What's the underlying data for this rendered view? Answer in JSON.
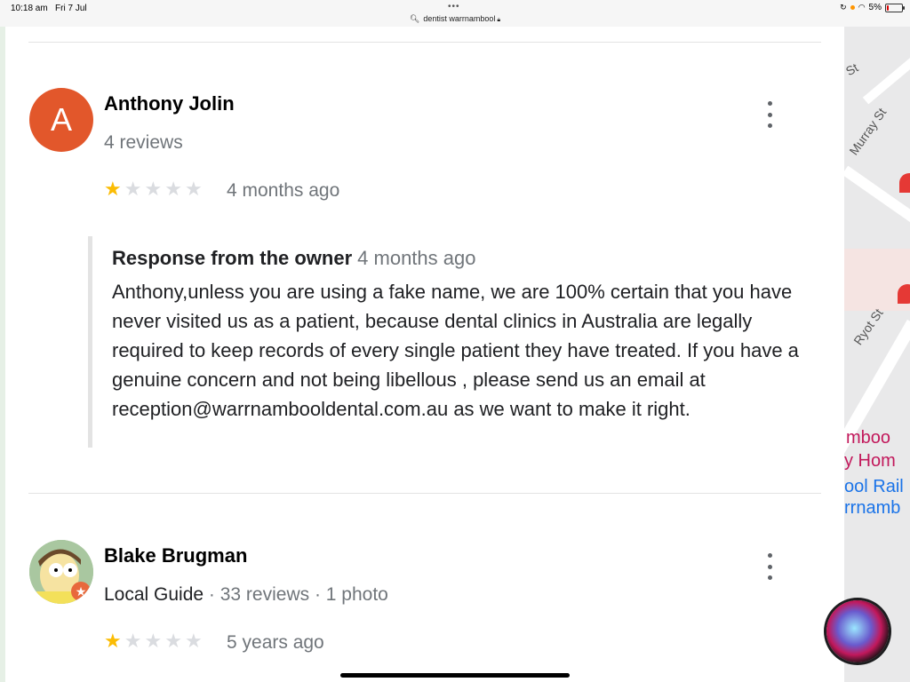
{
  "status_bar": {
    "time": "10:18 am",
    "date": "Fri 7 Jul",
    "dots": "•••",
    "url": "dentist warrnambool",
    "battery": "5%"
  },
  "map_labels": {
    "street_1": "Murray St",
    "street_2": "Ryot St",
    "street_3": "St",
    "place_1": "mboo",
    "place_2": "y Hom",
    "place_3": "ool Rail",
    "place_4": "rrnamb"
  },
  "reviews": [
    {
      "avatar_letter": "A",
      "avatar_color": "#e2572b",
      "name": "Anthony Jolin",
      "meta": "4 reviews",
      "rating": 1,
      "time": "4 months ago",
      "response": {
        "heading": "Response from the owner",
        "time": "4 months ago",
        "text": "Anthony,unless you are using a fake name, we are 100% certain that you have never visited us as a patient, because dental clinics in Australia are legally required to keep records of every single patient they have treated. If you have a genuine concern and not being libellous , please send us an email at reception@warrnambooldental.com.au as we want to make it right."
      }
    },
    {
      "avatar_icon": "cartoon-avatar",
      "name": "Blake Brugman",
      "guide": "Local Guide",
      "meta": " · 33 reviews · 1 photo",
      "rating": 1,
      "time": "5 years ago"
    }
  ],
  "colors": {
    "star_on": "#fbbc04",
    "star_off": "#dadce0"
  }
}
